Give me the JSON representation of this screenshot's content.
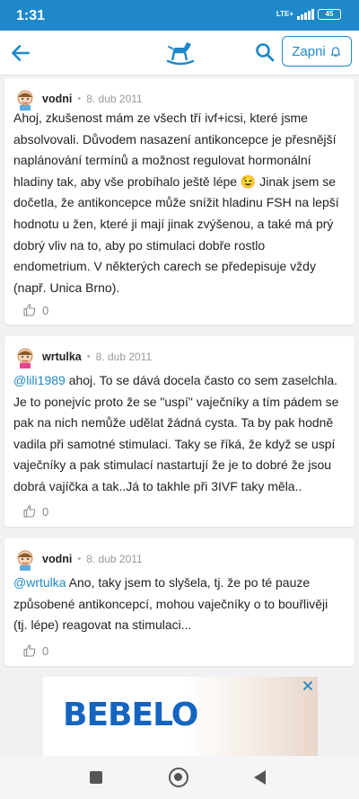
{
  "status": {
    "time": "1:31",
    "network": "LTE+",
    "battery": "45"
  },
  "header": {
    "zapni_label": "Zapni"
  },
  "posts": [
    {
      "user": "vodni",
      "separator": "•",
      "date": "8. dub 2011",
      "mention": "",
      "lines": [
        "Ahoj, zkušenost mám ze všech tří ivf+icsi, které jsme",
        "absolvovali. Důvodem nasazení antikoncepce je přesnější",
        "naplánování termínů a možnost regulovat hormonální",
        "hladiny tak, aby vše probíhalo ještě lépe 😉 Jinak jsem se",
        "dočetla, že antikoncepce může snížit hladinu FSH na lepší",
        "hodnotu u žen, které ji mají jinak zvýšenou, a také má prý",
        "dobrý vliv na to, aby po stimulaci dobře rostlo",
        "endometrium. V některých carech se předepisuje vždy",
        "(např. Unica Brno)."
      ],
      "likes": "0"
    },
    {
      "user": "wrtulka",
      "separator": "•",
      "date": "8. dub 2011",
      "mention": "@lili1989",
      "lines": [
        " ahoj. To se dává docela často co sem zaselchla.",
        "Je to ponejvíc proto že se \"uspí\" vaječníky a tím pádem se",
        "pak na nich nemůže udělat žádná cysta. Ta by pak hodně",
        "vadila při samotné stimulaci. Taky se říká, že když se uspí",
        "vaječníky a pak stimulací nastartují že je to dobré že jsou",
        "dobrá vajíčka a tak..Já to takhle při 3IVF taky měla.."
      ],
      "likes": "0"
    },
    {
      "user": "vodni",
      "separator": "•",
      "date": "8. dub 2011",
      "mention": "@wrtulka",
      "lines": [
        " Ano, taky jsem to slyšela, tj. že po té pauze",
        "způsobené antikoncepcí, mohou vaječníky o to bouřlivěji",
        "(tj. lépe) reagovat na stimulaci..."
      ],
      "likes": "0"
    }
  ],
  "ad": {
    "brand": "BEBELO"
  },
  "colors": {
    "accent": "#1e88c9",
    "brand_blue": "#1565c0"
  }
}
